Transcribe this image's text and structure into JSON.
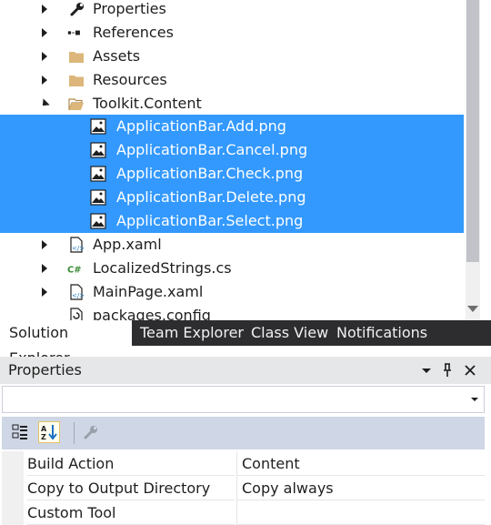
{
  "solution_tree": {
    "items": [
      {
        "label": "Properties",
        "icon": "wrench-icon",
        "expander": "collapsed"
      },
      {
        "label": "References",
        "icon": "references-icon",
        "expander": "collapsed"
      },
      {
        "label": "Assets",
        "icon": "folder-icon",
        "expander": "collapsed"
      },
      {
        "label": "Resources",
        "icon": "folder-icon",
        "expander": "collapsed"
      },
      {
        "label": "Toolkit.Content",
        "icon": "folder-open-icon",
        "expander": "expanded"
      },
      {
        "label": "ApplicationBar.Add.png",
        "icon": "image-file-icon",
        "selected": true
      },
      {
        "label": "ApplicationBar.Cancel.png",
        "icon": "image-file-icon",
        "selected": true
      },
      {
        "label": "ApplicationBar.Check.png",
        "icon": "image-file-icon",
        "selected": true
      },
      {
        "label": "ApplicationBar.Delete.png",
        "icon": "image-file-icon",
        "selected": true
      },
      {
        "label": "ApplicationBar.Select.png",
        "icon": "image-file-icon",
        "selected": true
      },
      {
        "label": "App.xaml",
        "icon": "xaml-file-icon",
        "expander": "collapsed"
      },
      {
        "label": "LocalizedStrings.cs",
        "icon": "csharp-file-icon",
        "expander": "collapsed"
      },
      {
        "label": "MainPage.xaml",
        "icon": "xaml-file-icon",
        "expander": "collapsed"
      },
      {
        "label": "packages.config",
        "icon": "config-file-icon"
      }
    ]
  },
  "tabs": [
    {
      "label": "Solution Explorer",
      "active": true
    },
    {
      "label": "Team Explorer"
    },
    {
      "label": "Class View"
    },
    {
      "label": "Notifications"
    }
  ],
  "properties": {
    "title": "Properties",
    "header_buttons": [
      "dropdown-icon",
      "pin-icon",
      "close-icon"
    ],
    "toolbar": [
      "categorized-icon",
      "alphabetical-icon",
      "wrench-icon"
    ],
    "rows": [
      {
        "name": "Build Action",
        "value": "Content"
      },
      {
        "name": "Copy to Output Directory",
        "value": "Copy always"
      },
      {
        "name": "Custom Tool",
        "value": ""
      }
    ]
  },
  "colors": {
    "selection": "#3399ff",
    "tab_bar": "#2d2d30",
    "header": "#e6e7e8",
    "toolbar": "#cfd6e5"
  }
}
